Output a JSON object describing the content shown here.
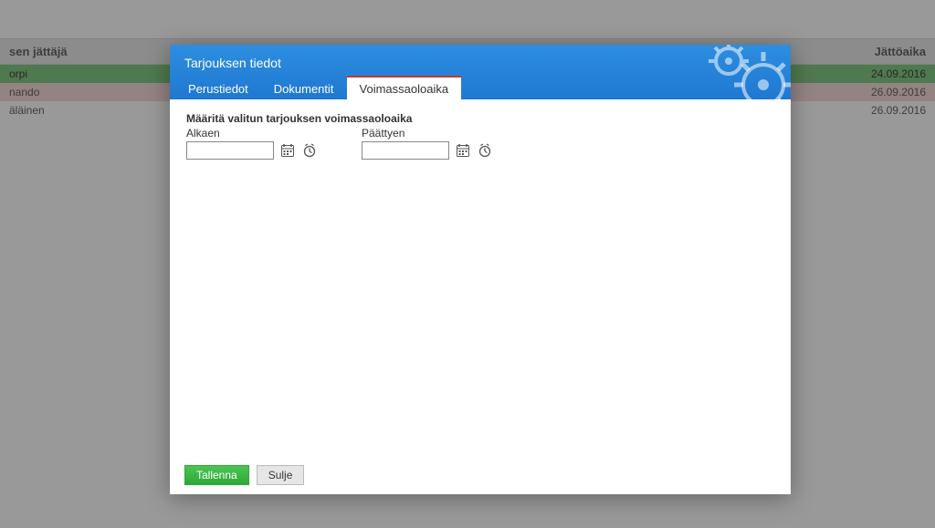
{
  "table": {
    "colJattaja": "sen jättäjä",
    "colJattoaika": "Jättöaika",
    "rows": [
      {
        "name": "orpi",
        "date": "24.09.2016",
        "cls": "green"
      },
      {
        "name": "nando",
        "date": "26.09.2016",
        "cls": "pink"
      },
      {
        "name": "äläinen",
        "date": "26.09.2016",
        "cls": "plain"
      }
    ]
  },
  "dialog": {
    "title": "Tarjouksen tiedot",
    "tabs": {
      "perustiedot": "Perustiedot",
      "dokumentit": "Dokumentit",
      "voimassa": "Voimassaoloaika"
    },
    "sectionTitle": "Määritä valitun tarjouksen voimassaoloaika",
    "alkaenLabel": "Alkaen",
    "paattyenLabel": "Päättyen",
    "alkaenValue": "",
    "paattyenValue": "",
    "save": "Tallenna",
    "close": "Sulje"
  }
}
